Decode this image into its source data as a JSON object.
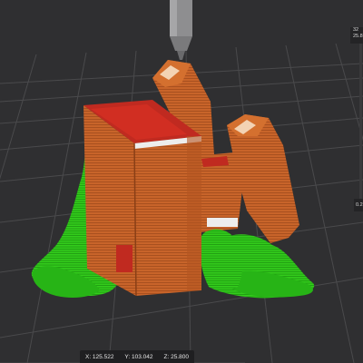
{
  "viewport": {
    "label": "3D print preview",
    "colors": {
      "background": "#2f2f31",
      "grid": "#4a4a4c",
      "model": "#c8642a",
      "model_dark": "#a04d1e",
      "top_surface": "#c02a20",
      "support": "#2fc41a",
      "nozzle": "#9a9a9a"
    }
  },
  "coords": {
    "x": "X: 125.522",
    "y": "Y: 103.042",
    "z": "Z: 25.800"
  },
  "layer_slider": {
    "top_value": "32",
    "top_height": "25.8",
    "bottom_value": "0.2"
  }
}
